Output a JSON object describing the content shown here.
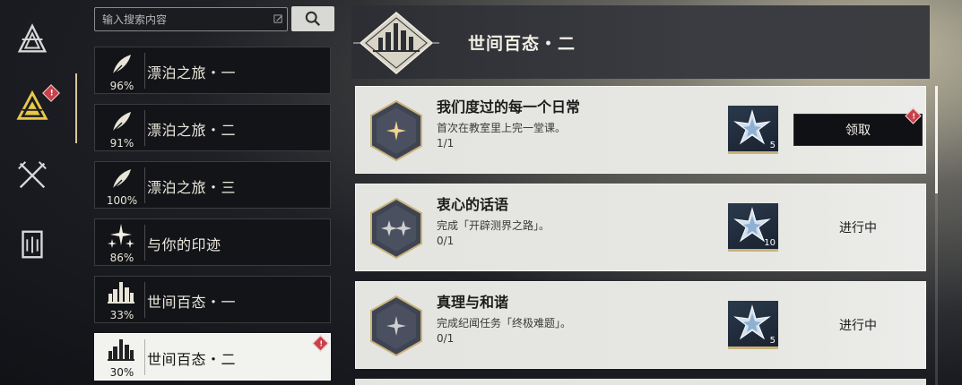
{
  "search": {
    "placeholder": "输入搜索内容"
  },
  "rail": {
    "items": [
      {
        "icon": "triangle-logo-icon",
        "active": false,
        "badge": ""
      },
      {
        "icon": "achievement-triangle-icon",
        "active": true,
        "badge": "!"
      },
      {
        "icon": "crossed-swords-icon",
        "active": false,
        "badge": ""
      },
      {
        "icon": "card-deck-icon",
        "active": false,
        "badge": ""
      }
    ]
  },
  "categories": [
    {
      "label": "漂泊之旅・一",
      "percent": "96%",
      "icon": "feather-icon",
      "active": false,
      "badge": ""
    },
    {
      "label": "漂泊之旅・二",
      "percent": "91%",
      "icon": "feather-icon",
      "active": false,
      "badge": ""
    },
    {
      "label": "漂泊之旅・三",
      "percent": "100%",
      "icon": "feather-icon",
      "active": false,
      "badge": ""
    },
    {
      "label": "与你的印迹",
      "percent": "86%",
      "icon": "sparkle-stars-icon",
      "active": false,
      "badge": ""
    },
    {
      "label": "世间百态・一",
      "percent": "33%",
      "icon": "city-skyline-icon",
      "active": false,
      "badge": ""
    },
    {
      "label": "世间百态・二",
      "percent": "30%",
      "icon": "city-skyline-icon",
      "active": true,
      "badge": "!"
    }
  ],
  "header": {
    "title": "世间百态・二",
    "emblem": "city-skyline-emblem-icon"
  },
  "achievements": [
    {
      "title": "我们度过的每一个日常",
      "description": "首次在教室里上完一堂课。",
      "progress": "1/1",
      "reward_icon": "star-crystal-icon",
      "reward_count": "5",
      "action": "领取",
      "claimable": true,
      "badge": "!",
      "hex_icon": "single-sparkle-icon"
    },
    {
      "title": "衷心的话语",
      "description": "完成「开辟测界之路」。",
      "progress": "0/1",
      "reward_icon": "star-crystal-icon",
      "reward_count": "10",
      "action": "进行中",
      "claimable": false,
      "badge": "",
      "hex_icon": "double-sparkle-icon"
    },
    {
      "title": "真理与和谐",
      "description": "完成纪闻任务「终极难题」。",
      "progress": "0/1",
      "reward_icon": "star-crystal-icon",
      "reward_count": "5",
      "action": "进行中",
      "claimable": false,
      "badge": "",
      "hex_icon": "single-sparkle-icon"
    }
  ],
  "colors": {
    "accent_gold": "#d8c79a",
    "badge_red": "#c8404a",
    "card_bg": "#e4e4e0",
    "claim_btn": "#101114"
  }
}
